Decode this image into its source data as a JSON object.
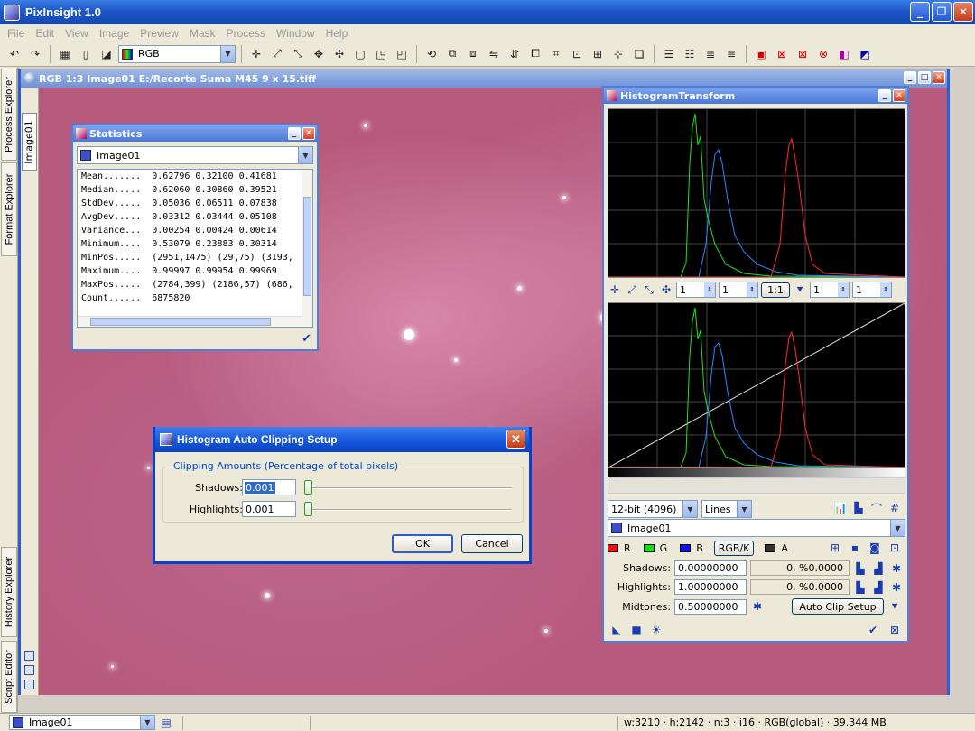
{
  "app": {
    "title": "PixInsight 1.0"
  },
  "menu": [
    "File",
    "Edit",
    "View",
    "Image",
    "Preview",
    "Mask",
    "Process",
    "Window",
    "Help"
  ],
  "toolbar": {
    "color_space": "RGB"
  },
  "side_tabs": {
    "process_explorer": "Process Explorer",
    "format_explorer": "Format Explorer",
    "history_explorer": "History Explorer",
    "script_editor": "Script Editor"
  },
  "image_window": {
    "title": "RGB 1:3 Image01 E:/Recorte Suma M45 9 x 15.tiff",
    "tab": "Image01"
  },
  "statistics": {
    "title": "Statistics",
    "view": "Image01",
    "lines": [
      "Mean.......  0.62796 0.32100 0.41681",
      "Median.....  0.62060 0.30860 0.39521",
      "StdDev.....  0.05036 0.06511 0.07838",
      "AvgDev.....  0.03312 0.03444 0.05108",
      "Variance...  0.00254 0.00424 0.00614",
      "Minimum....  0.53079 0.23883 0.30314",
      "MinPos.....  (2951,1475) (29,75) (3193,",
      "Maximum....  0.99997 0.99954 0.99969",
      "MaxPos.....  (2784,399) (2186,57) (686,",
      "Count......  6875820"
    ]
  },
  "histogram": {
    "title": "HistogramTransform",
    "zoom": {
      "h1": "1",
      "v1": "1",
      "ratio": "1:1",
      "h2": "1",
      "v2": "1"
    },
    "resolution": "12-bit (4096)",
    "graph_style": "Lines",
    "view": "Image01",
    "channels": {
      "r": "R",
      "g": "G",
      "b": "B",
      "rgbk": "RGB/K",
      "a": "A"
    },
    "shadows_label": "Shadows:",
    "shadows_value": "0.00000000",
    "shadows_clip": "0, %0.0000",
    "highlights_label": "Highlights:",
    "highlights_value": "1.00000000",
    "highlights_clip": "0, %0.0000",
    "midtones_label": "Midtones:",
    "midtones_value": "0.50000000",
    "auto_clip_button": "Auto Clip Setup"
  },
  "dialog": {
    "title": "Histogram Auto Clipping Setup",
    "group_title": "Clipping Amounts (Percentage of total pixels)",
    "shadows_label": "Shadows:",
    "shadows_value": "0.001",
    "highlights_label": "Highlights:",
    "highlights_value": "0.001",
    "ok": "OK",
    "cancel": "Cancel"
  },
  "status": {
    "view": "Image01",
    "info": "w:3210 · h:2142 · n:3 · i16 · RGB(global) · 39.344 MB"
  },
  "colors": {
    "accent": "#2c5ed4",
    "background": "#b65a7d",
    "red": "#ff2a2a",
    "green": "#22e022",
    "blue": "#2a88ff"
  }
}
